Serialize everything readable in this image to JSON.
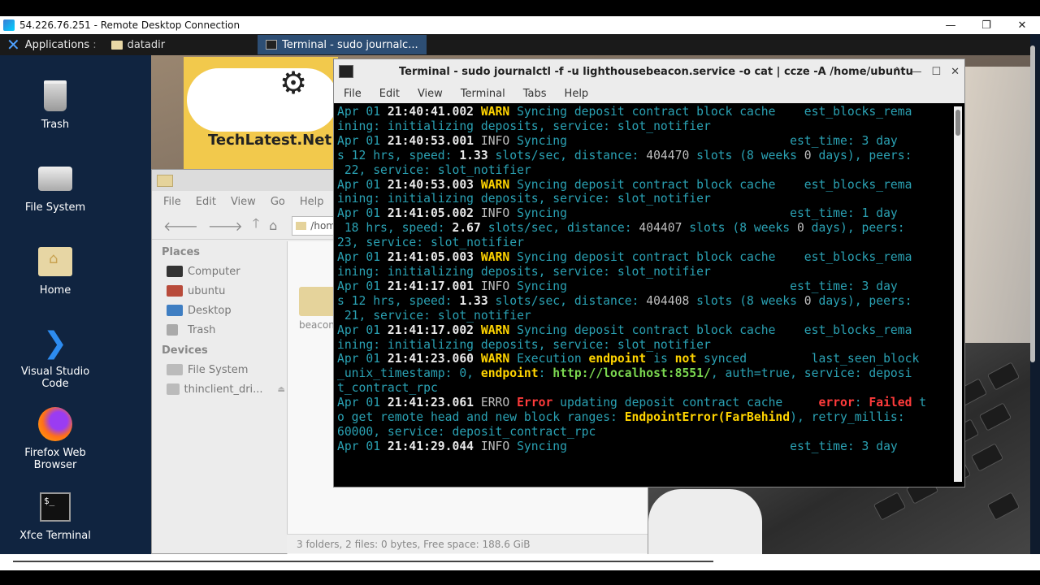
{
  "rdp": {
    "title": "54.226.76.251 - Remote Desktop Connection",
    "min": "—",
    "max": "❐",
    "close": "✕"
  },
  "panel": {
    "apps_label": "Applications",
    "apps_sep": ":",
    "task_datadir": "datadir",
    "task_terminal": "Terminal - sudo journalc..."
  },
  "desktop_icons": [
    {
      "label": "Trash"
    },
    {
      "label": "File System"
    },
    {
      "label": "Home"
    },
    {
      "label": "Visual Studio Code"
    },
    {
      "label": "Firefox Web Browser"
    },
    {
      "label": "Xfce Terminal"
    }
  ],
  "logo": {
    "text": "TechLatest.Net"
  },
  "file_manager": {
    "menu": [
      "File",
      "Edit",
      "View",
      "Go",
      "Help"
    ],
    "location": "/home/ubuntu",
    "places_header": "Places",
    "places": [
      "Computer",
      "ubuntu",
      "Desktop",
      "Trash"
    ],
    "devices_header": "Devices",
    "devices": [
      "File System",
      "thinclient_dri..."
    ],
    "folder_label": "beacon",
    "status": "3 folders, 2 files: 0 bytes, Free space: 188.6 GiB"
  },
  "terminal": {
    "title": "Terminal - sudo journalctl -f -u lighthousebeacon.service -o cat | ccze -A /home/ubuntu",
    "menu": [
      "File",
      "Edit",
      "View",
      "Terminal",
      "Tabs",
      "Help"
    ],
    "lines": [
      [
        [
          "c",
          "Apr 01 "
        ],
        [
          "t",
          "21:40:41.002"
        ],
        [
          "w",
          " WARN"
        ],
        [
          "c",
          " Syncing deposit contract block cache    est_blocks_rema"
        ]
      ],
      [
        [
          "c",
          "ining: initializing deposits, service: slot_notifier"
        ]
      ],
      [
        [
          "c",
          "Apr 01 "
        ],
        [
          "t",
          "21:40:53.001"
        ],
        [
          "i",
          " INFO"
        ],
        [
          "c",
          " Syncing                               est_time: 3 day"
        ]
      ],
      [
        [
          "c",
          "s 12 hrs, speed: "
        ],
        [
          "t",
          "1.33"
        ],
        [
          "c",
          " slots/sec, distance: "
        ],
        [
          "i",
          "404470"
        ],
        [
          "c",
          " slots (8 weeks "
        ],
        [
          "i",
          "0"
        ],
        [
          "c",
          " days), peers:"
        ]
      ],
      [
        [
          "c",
          " 22, service: slot_notifier"
        ]
      ],
      [
        [
          "c",
          "Apr 01 "
        ],
        [
          "t",
          "21:40:53.003"
        ],
        [
          "w",
          " WARN"
        ],
        [
          "c",
          " Syncing deposit contract block cache    est_blocks_rema"
        ]
      ],
      [
        [
          "c",
          "ining: initializing deposits, service: slot_notifier"
        ]
      ],
      [
        [
          "c",
          "Apr 01 "
        ],
        [
          "t",
          "21:41:05.002"
        ],
        [
          "i",
          " INFO"
        ],
        [
          "c",
          " Syncing                               est_time: 1 day"
        ]
      ],
      [
        [
          "c",
          " 18 hrs, speed: "
        ],
        [
          "t",
          "2.67"
        ],
        [
          "c",
          " slots/sec, distance: "
        ],
        [
          "i",
          "404407"
        ],
        [
          "c",
          " slots (8 weeks "
        ],
        [
          "i",
          "0"
        ],
        [
          "c",
          " days), peers:"
        ]
      ],
      [
        [
          "c",
          "23, service: slot_notifier"
        ]
      ],
      [
        [
          "c",
          "Apr 01 "
        ],
        [
          "t",
          "21:41:05.003"
        ],
        [
          "w",
          " WARN"
        ],
        [
          "c",
          " Syncing deposit contract block cache    est_blocks_rema"
        ]
      ],
      [
        [
          "c",
          "ining: initializing deposits, service: slot_notifier"
        ]
      ],
      [
        [
          "c",
          "Apr 01 "
        ],
        [
          "t",
          "21:41:17.001"
        ],
        [
          "i",
          " INFO"
        ],
        [
          "c",
          " Syncing                               est_time: 3 day"
        ]
      ],
      [
        [
          "c",
          "s 12 hrs, speed: "
        ],
        [
          "t",
          "1.33"
        ],
        [
          "c",
          " slots/sec, distance: "
        ],
        [
          "i",
          "404408"
        ],
        [
          "c",
          " slots (8 weeks "
        ],
        [
          "i",
          "0"
        ],
        [
          "c",
          " days), peers:"
        ]
      ],
      [
        [
          "c",
          " 21, service: slot_notifier"
        ]
      ],
      [
        [
          "c",
          "Apr 01 "
        ],
        [
          "t",
          "21:41:17.002"
        ],
        [
          "w",
          " WARN"
        ],
        [
          "c",
          " Syncing deposit contract block cache    est_blocks_rema"
        ]
      ],
      [
        [
          "c",
          "ining: initializing deposits, service: slot_notifier"
        ]
      ],
      [
        [
          "c",
          "Apr 01 "
        ],
        [
          "t",
          "21:41:23.060"
        ],
        [
          "w",
          " WARN"
        ],
        [
          "c",
          " Execution "
        ],
        [
          "y",
          "endpoint"
        ],
        [
          "c",
          " is "
        ],
        [
          "y",
          "not"
        ],
        [
          "c",
          " synced         last_seen_block"
        ]
      ],
      [
        [
          "c",
          "_unix_timestamp: 0, "
        ],
        [
          "y",
          "endpoint"
        ],
        [
          "c",
          ": "
        ],
        [
          "g",
          "http://localhost:8551/"
        ],
        [
          "c",
          ", auth=true, service: deposi"
        ]
      ],
      [
        [
          "c",
          "t_contract_rpc"
        ]
      ],
      [
        [
          "c",
          "Apr 01 "
        ],
        [
          "t",
          "21:41:23.061"
        ],
        [
          "i",
          " ERRO"
        ],
        [
          "e",
          " Error"
        ],
        [
          "c",
          " updating deposit contract cache     "
        ],
        [
          "e",
          "error"
        ],
        [
          "c",
          ": "
        ],
        [
          "e",
          "Failed"
        ],
        [
          "c",
          " t"
        ]
      ],
      [
        [
          "c",
          "o get remote head and new block ranges: "
        ],
        [
          "y",
          "EndpointError(FarBehind"
        ],
        [
          "c",
          "), retry_millis:"
        ]
      ],
      [
        [
          "c",
          "60000, service: deposit_contract_rpc"
        ]
      ],
      [
        [
          "c",
          "Apr 01 "
        ],
        [
          "t",
          "21:41:29.044"
        ],
        [
          "i",
          " INFO"
        ],
        [
          "c",
          " Syncing                               est_time: 3 day"
        ]
      ]
    ]
  }
}
